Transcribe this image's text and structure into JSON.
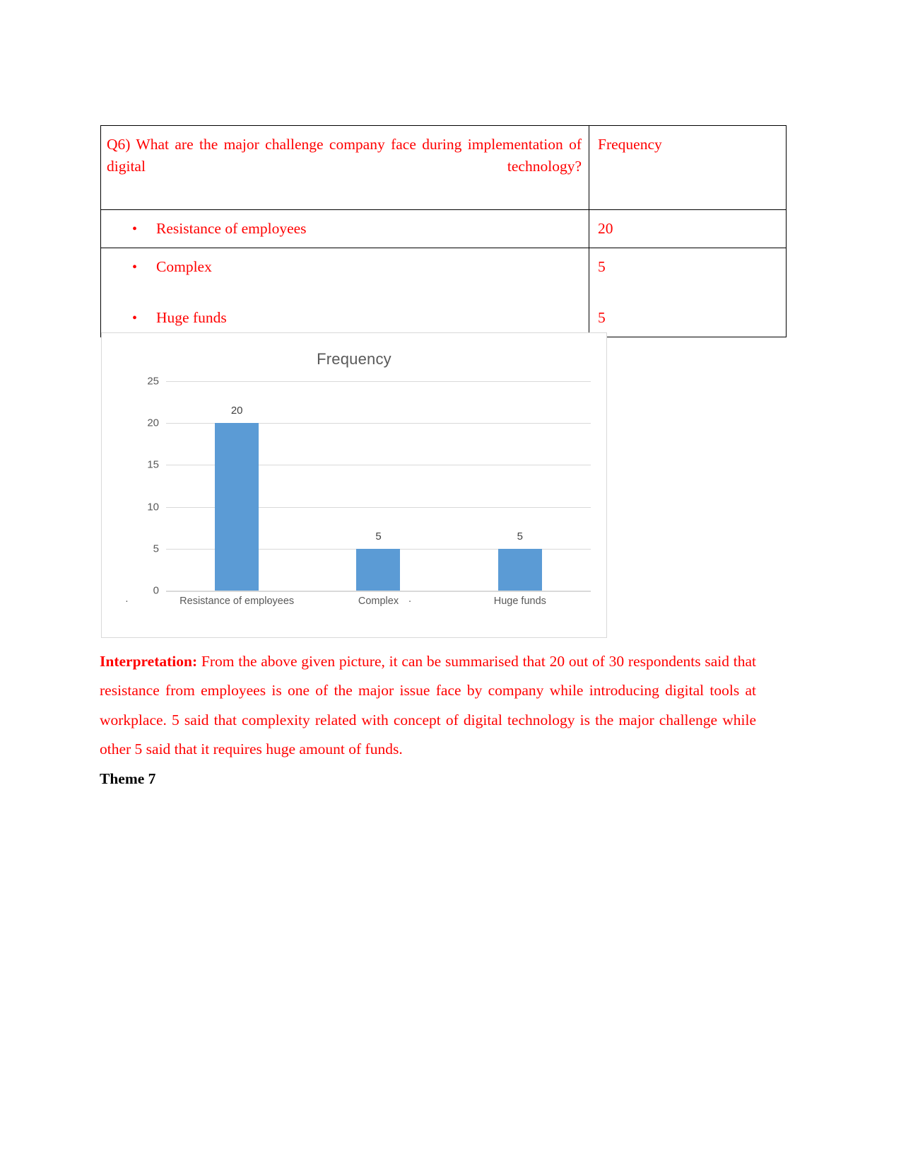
{
  "table": {
    "question": "Q6)  What are the major challenge company face during implementation of digital technology?",
    "frequency_header": "Frequency",
    "bullet_glyph": "•",
    "rows": [
      {
        "label": "Resistance of employees",
        "value": "20"
      },
      {
        "label": "Complex",
        "value": "5"
      },
      {
        "label": "Huge funds",
        "value": "5"
      }
    ]
  },
  "chart_data": {
    "type": "bar",
    "title": "Frequency",
    "categories": [
      "Resistance of employees",
      "Complex",
      "Huge funds"
    ],
    "category_markers": [
      "·",
      "·",
      "·"
    ],
    "values": [
      20,
      5,
      5
    ],
    "data_labels": [
      "20",
      "5",
      "5"
    ],
    "xlabel": "",
    "ylabel": "",
    "ylim": [
      0,
      25
    ],
    "yticks": [
      "0",
      "5",
      "10",
      "15",
      "20",
      "25"
    ],
    "ytick_values": [
      0,
      5,
      10,
      15,
      20,
      25
    ],
    "grid": true,
    "legend": "none",
    "series_color": "#5B9BD5",
    "gridline_color": "#D9D9D9",
    "title_color": "#595959",
    "border_color": "#D9D9D9"
  },
  "interpretation": {
    "lead": "Interpretation:",
    "body": " From the above given picture, it can be summarised that 20 out of 30 respondents said that resistance from employees is one of the major issue face by company while introducing digital tools at workplace. 5 said that complexity related with concept of digital technology is the major challenge while other 5 said that it requires huge amount of funds.",
    "color": "#FF0000"
  },
  "theme": {
    "label": "Theme 7"
  }
}
